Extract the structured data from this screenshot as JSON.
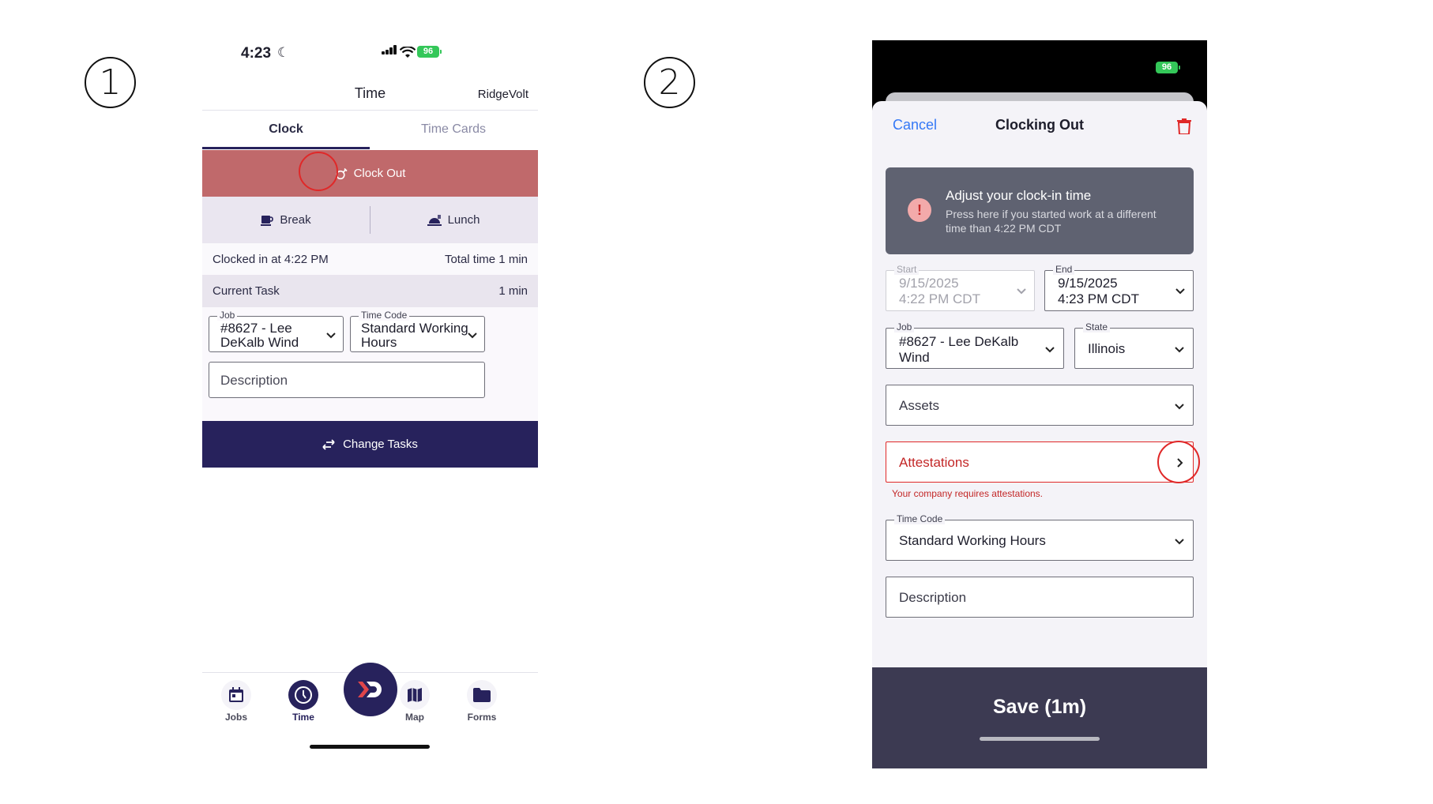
{
  "steps": [
    "1",
    "2"
  ],
  "phone1": {
    "status": {
      "time": "4:23",
      "battery": "96"
    },
    "header": {
      "title": "Time",
      "org": "RidgeVolt"
    },
    "tabs": [
      {
        "label": "Clock",
        "active": true
      },
      {
        "label": "Time Cards",
        "active": false
      }
    ],
    "clock_out_label": "Clock Out",
    "break_label": "Break",
    "lunch_label": "Lunch",
    "clocked_in_text": "Clocked in at 4:22 PM",
    "total_time_text": "Total time 1 min",
    "current_task_label": "Current Task",
    "current_task_duration": "1 min",
    "job": {
      "label": "Job",
      "value_line1": "#8627 - Lee",
      "value_line2": "DeKalb Wind"
    },
    "time_code": {
      "label": "Time Code",
      "value_line1": "Standard Working",
      "value_line2": "Hours"
    },
    "description_placeholder": "Description",
    "change_tasks_label": "Change Tasks",
    "nav": [
      {
        "label": "Jobs",
        "icon": "calendar-icon"
      },
      {
        "label": "Time",
        "icon": "clock-icon",
        "active": true
      },
      {
        "label": "Map",
        "icon": "map-icon"
      },
      {
        "label": "Forms",
        "icon": "folder-icon"
      }
    ],
    "colors": {
      "clock_out": "#c0696b",
      "brand": "#27225c"
    }
  },
  "phone2": {
    "status": {
      "battery": "96"
    },
    "cancel_label": "Cancel",
    "title": "Clocking Out",
    "adjust": {
      "title": "Adjust your clock-in time",
      "subtitle": "Press here if you started work at a different time than 4:22 PM CDT"
    },
    "start": {
      "label": "Start",
      "date": "9/15/2025",
      "time": "4:22 PM CDT"
    },
    "end": {
      "label": "End",
      "date": "9/15/2025",
      "time": "4:23 PM CDT"
    },
    "job": {
      "label": "Job",
      "value_line1": "#8627 - Lee DeKalb",
      "value_line2": "Wind"
    },
    "state": {
      "label": "State",
      "value": "Illinois"
    },
    "assets_placeholder": "Assets",
    "attestations_label": "Attestations",
    "attestations_error": "Your company requires attestations.",
    "time_code": {
      "label": "Time Code",
      "value": "Standard Working Hours"
    },
    "description_placeholder": "Description",
    "save_label": "Save (1m)",
    "colors": {
      "link": "#3478f6",
      "error": "#e02828",
      "save_bar": "#3c3a52"
    }
  }
}
